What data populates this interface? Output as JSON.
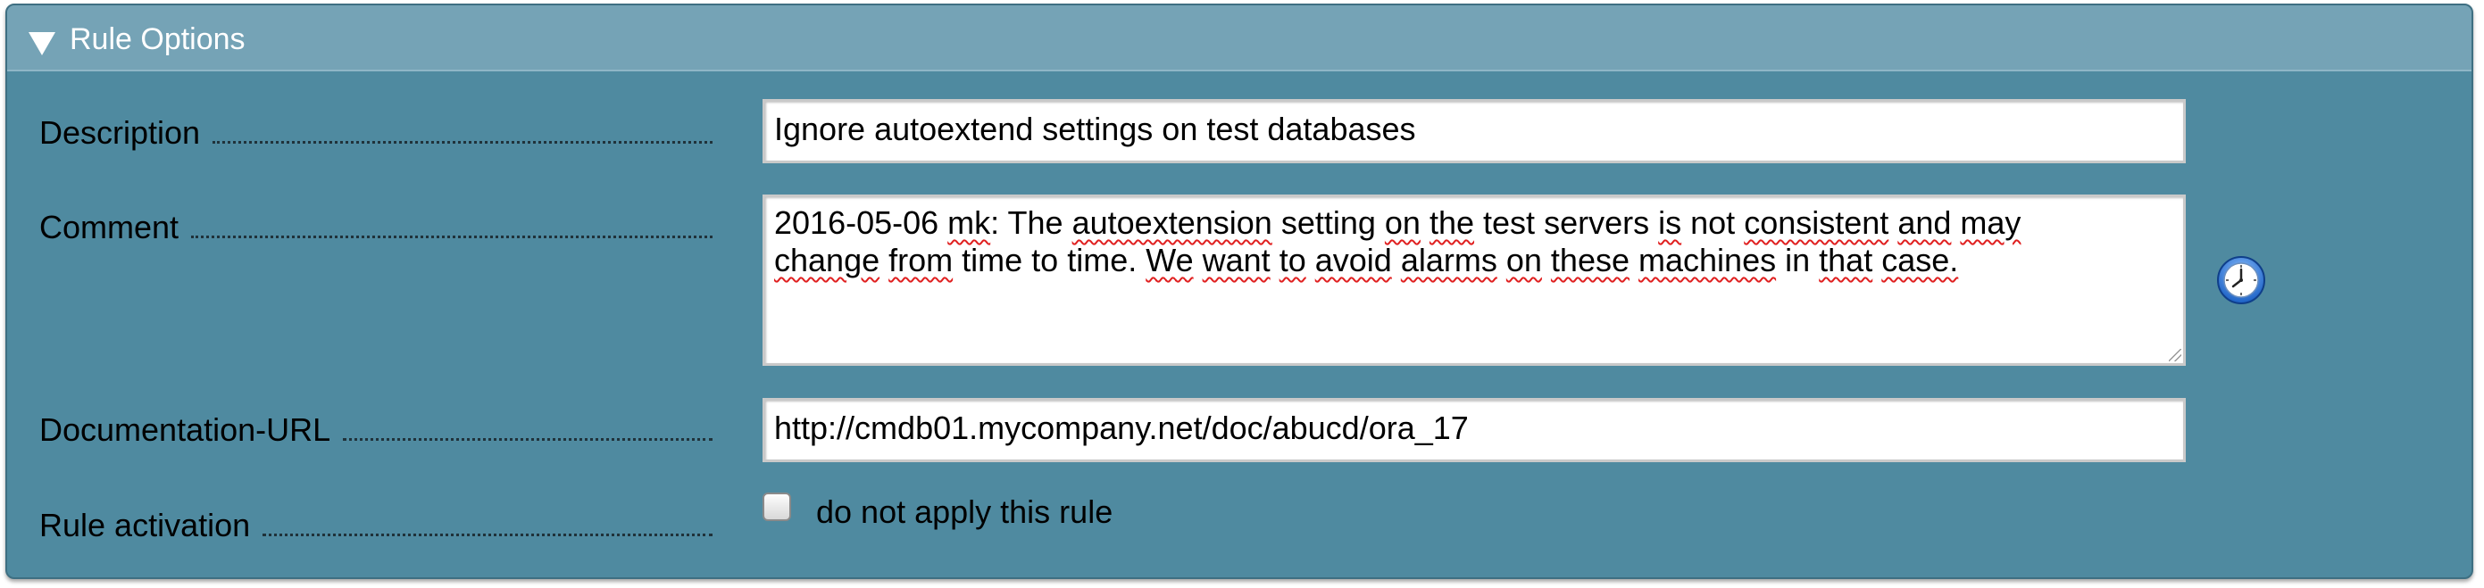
{
  "header": {
    "title": "Rule Options",
    "toggle_icon": "triangle-down-icon"
  },
  "description": {
    "label": "Description",
    "value": "Ignore autoextend settings on test databases"
  },
  "comment": {
    "label": "Comment",
    "line1": [
      "2016-05-06",
      "mk",
      ":",
      "The",
      "autoextension",
      "setting",
      "on",
      "the",
      "test",
      "servers",
      "is",
      "not",
      "consistent",
      "and",
      "may"
    ],
    "line2": [
      "change",
      "from",
      "time",
      "to",
      "time.",
      "We",
      "want",
      "to",
      "avoid",
      "alarms",
      "on",
      "these",
      "machines",
      "in",
      "that",
      "case."
    ],
    "timestamp_icon": "clock-icon"
  },
  "documentation_url": {
    "label": "Documentation-URL",
    "value": "http://cmdb01.mycompany.net/doc/abucd/ora_17"
  },
  "rule_activation": {
    "label": "Rule activation",
    "checkbox_label": "do not apply this rule",
    "checked": false
  },
  "colors": {
    "panel_bg": "#4f8aa0",
    "header_bg": "#75a3b6",
    "spell_underline": "#e02020"
  }
}
